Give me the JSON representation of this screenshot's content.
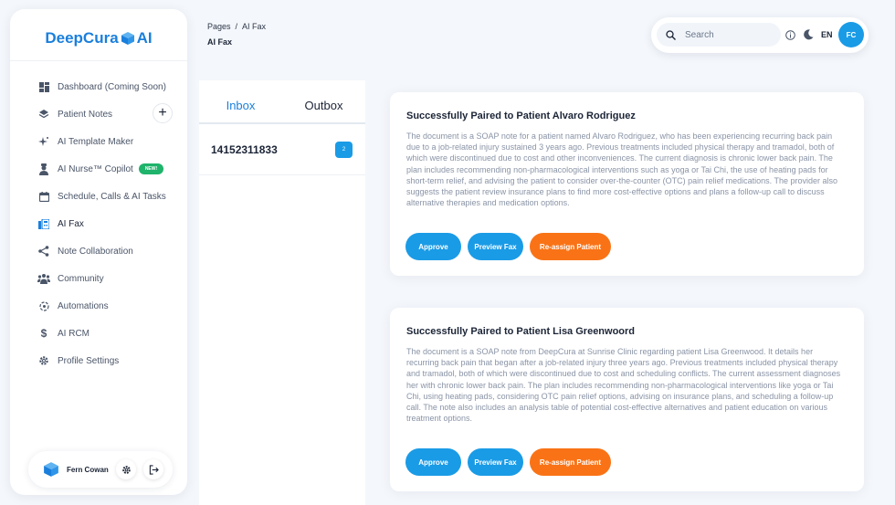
{
  "app": {
    "logo_text": "DeepCura",
    "logo_suffix": "AI",
    "accent": "#1a9be6",
    "brand": "#1a7fdc",
    "warning": "#f97316"
  },
  "sidebar": {
    "items": [
      {
        "label": "Dashboard (Coming Soon)",
        "icon": "dashboard-icon"
      },
      {
        "label": "Patient Notes",
        "icon": "layers-icon"
      },
      {
        "label": "AI Template Maker",
        "icon": "sparkle-icon"
      },
      {
        "label": "AI Nurse™ Copilot",
        "icon": "nurse-icon",
        "badge": "NEW!"
      },
      {
        "label": "Schedule, Calls & AI Tasks",
        "icon": "calendar-icon"
      },
      {
        "label": "AI Fax",
        "icon": "fax-icon",
        "active": true
      },
      {
        "label": "Note Collaboration",
        "icon": "share-icon"
      },
      {
        "label": "Community",
        "icon": "community-icon"
      },
      {
        "label": "Automations",
        "icon": "automation-icon"
      },
      {
        "label": "AI RCM",
        "icon": "dollar-icon"
      },
      {
        "label": "Profile Settings",
        "icon": "gear-icon"
      }
    ],
    "add_button": "+",
    "user": {
      "name": "Fern Cowan"
    }
  },
  "header": {
    "breadcrumb": [
      "Pages",
      "AI Fax"
    ],
    "breadcrumb_sep": "/",
    "title": "AI Fax",
    "search_placeholder": "Search",
    "language": "EN",
    "avatar_initials": "FC"
  },
  "fax_panel": {
    "tabs": [
      "Inbox",
      "Outbox"
    ],
    "active_tab": "Inbox",
    "items": [
      {
        "number": "14152311833",
        "count": "2"
      }
    ]
  },
  "cards": [
    {
      "title": "Successfully Paired to Patient Alvaro Rodriguez",
      "body": "The document is a SOAP note for a patient named Alvaro Rodriguez, who has been experiencing recurring back pain due to a job-related injury sustained 3 years ago. Previous treatments included physical therapy and tramadol, both of which were discontinued due to cost and other inconveniences. The current diagnosis is chronic lower back pain. The plan includes recommending non-pharmacological interventions such as yoga or Tai Chi, the use of heating pads for short-term relief, and advising the patient to consider over-the-counter (OTC) pain relief medications. The provider also suggests the patient review insurance plans to find more cost-effective options and plans a follow-up call to discuss alternative therapies and medication options.",
      "buttons": {
        "approve": "Approve",
        "preview": "Preview Fax",
        "reassign": "Re-assign Patient"
      }
    },
    {
      "title": "Successfully Paired to Patient Lisa Greenwoord",
      "body": "The document is a SOAP note from DeepCura at Sunrise Clinic regarding patient Lisa Greenwood. It details her recurring back pain that began after a job-related injury three years ago. Previous treatments included physical therapy and tramadol, both of which were discontinued due to cost and scheduling conflicts. The current assessment diagnoses her with chronic lower back pain. The plan includes recommending non-pharmacological interventions like yoga or Tai Chi, using heating pads, considering OTC pain relief options, advising on insurance plans, and scheduling a follow-up call. The note also includes an analysis table of potential cost-effective alternatives and patient education on various treatment options.",
      "buttons": {
        "approve": "Approve",
        "preview": "Preview Fax",
        "reassign": "Re-assign Patient"
      }
    }
  ]
}
